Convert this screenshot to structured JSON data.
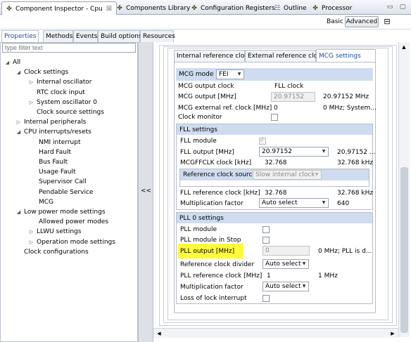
{
  "tabs": [
    {
      "label": "Component Inspector - Cpu",
      "icon": "component-icon",
      "active": true
    },
    {
      "label": "Components Library",
      "icon": "library-icon"
    },
    {
      "label": "Configuration Registers",
      "icon": "registers-icon"
    },
    {
      "label": "Outline",
      "icon": "outline-icon"
    },
    {
      "label": "Processor",
      "icon": "processor-icon"
    }
  ],
  "tab_close": "☒",
  "window_controls": {
    "minimize": "▭",
    "maximize": "▢"
  },
  "toolbar": {
    "basic": "Basic",
    "advanced": "Advanced",
    "view_menu": "⊟"
  },
  "subtabs": [
    "Properties",
    "Methods",
    "Events",
    "Build options",
    "Resources"
  ],
  "filter": {
    "placeholder": "type filter text"
  },
  "tree": [
    {
      "label": "All",
      "level": 0,
      "arrow": "◢"
    },
    {
      "label": "Clock settings",
      "level": 1,
      "arrow": "◢"
    },
    {
      "label": "Internal oscillator",
      "level": 2,
      "arrow": "▷"
    },
    {
      "label": "RTC clock input",
      "level": 2,
      "arrow": ""
    },
    {
      "label": "System oscillator 0",
      "level": 2,
      "arrow": "▷"
    },
    {
      "label": "Clock source settings",
      "level": 2,
      "arrow": ""
    },
    {
      "label": "Internal peripherals",
      "level": 1,
      "arrow": "▷"
    },
    {
      "label": "CPU interrupts/resets",
      "level": 1,
      "arrow": "◢"
    },
    {
      "label": "NMI interrupt",
      "level": 2.5,
      "arrow": ""
    },
    {
      "label": "Hard Fault",
      "level": 2.5,
      "arrow": ""
    },
    {
      "label": "Bus Fault",
      "level": 2.5,
      "arrow": ""
    },
    {
      "label": "Usage Fault",
      "level": 2.5,
      "arrow": ""
    },
    {
      "label": "Supervisor Call",
      "level": 2.5,
      "arrow": ""
    },
    {
      "label": "Pendable Service",
      "level": 2.5,
      "arrow": ""
    },
    {
      "label": "MCG",
      "level": 2.5,
      "arrow": ""
    },
    {
      "label": "Low power mode settings",
      "level": 1,
      "arrow": "◢"
    },
    {
      "label": "Allowed power modes",
      "level": 2.5,
      "arrow": ""
    },
    {
      "label": "LLWU settings",
      "level": 2,
      "arrow": "▷"
    },
    {
      "label": "Operation mode settings",
      "level": 2,
      "arrow": "▷"
    },
    {
      "label": "Clock configurations",
      "level": 1,
      "arrow": ""
    }
  ],
  "splitter": {
    "label": "<<"
  },
  "inner_tabs": [
    "Internal reference cloc",
    "External reference cloc",
    "MCG settings"
  ],
  "mcg": {
    "mode_label": "MCG mode",
    "mode_value": "FEI",
    "out_clock_label": "MCG output clock",
    "out_clock_value": "FLL clock",
    "out_label": "MCG output [MHz]",
    "out_field": "20.97152",
    "out_value": "20.97152 MHz",
    "ext_label": "MCG external ref. clock [MHz]",
    "ext_field": "0",
    "ext_value": "0 MHz; System...",
    "monitor_label": "Clock monitor"
  },
  "fll": {
    "title": "FLL settings",
    "module_label": "FLL module",
    "out_label": "FLL output [MHz]",
    "out_field": "20.97152",
    "out_value": "20.97152 ...",
    "mcgff_label": "MCGFFCLK clock [kHz]",
    "mcgff_field": "32.768",
    "mcgff_value": "32.768 kHz",
    "refsrc_label": "Reference clock source",
    "refsrc_value": "Slow internal clock",
    "refclk_label": "FLL reference clock [kHz]",
    "refclk_field": "32.768",
    "refclk_value": "32.768 kHz",
    "mult_label": "Multiplication factor",
    "mult_field": "Auto select",
    "mult_value": "640"
  },
  "pll": {
    "title": "PLL 0 settings",
    "module_label": "PLL module",
    "stop_label": "PLL module in Stop",
    "out_label": "PLL output [MHz]",
    "out_field": "0",
    "out_value": "0 MHz; PLL is d...",
    "div_label": "Reference clock divider",
    "div_field": "Auto select",
    "ref_label": "PLL reference clock [MHz]",
    "ref_field": "1",
    "ref_value": "1 MHz",
    "mult_label": "Multiplication factor",
    "mult_field": "Auto select",
    "lol_label": "Loss of lock interrupt"
  },
  "colors": {
    "highlight": "#fffb3a",
    "section_header": "#cfdcef",
    "active_tab_text": "#1b4d9c"
  }
}
